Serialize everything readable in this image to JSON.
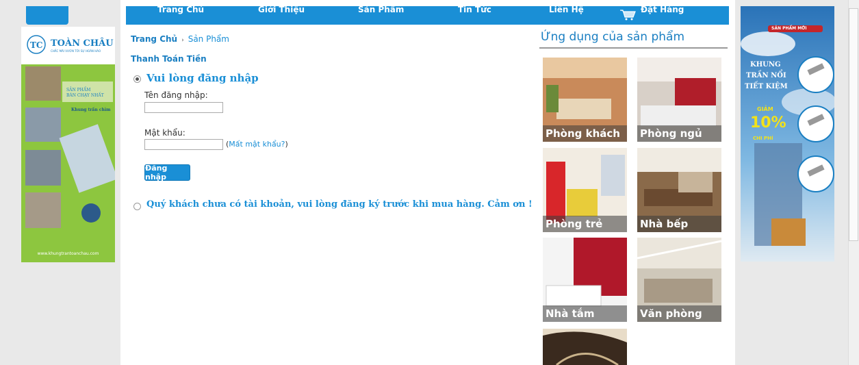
{
  "nav": {
    "items": [
      "Trang Chủ",
      "Giới Thiệu",
      "Sản Phẩm",
      "Tin Tức",
      "Liên Hệ",
      "Đặt Hàng"
    ]
  },
  "breadcrumb": {
    "home": "Trang Chủ",
    "separator": "›",
    "current": "Sản Phẩm"
  },
  "page_title": "Thanh Toán Tiền",
  "login": {
    "title": "Vui lòng đăng nhập",
    "username_label": "Tên đăng nhập:",
    "password_label": "Mật khẩu:",
    "forgot_open": "(",
    "forgot_link": "Mất mật khẩu?",
    "forgot_close": ")",
    "button": "Đăng nhập"
  },
  "register_option": "Quý khách chưa có tài khoản, vui lòng đăng ký trước khi mua hàng. Cảm ơn !",
  "applications": {
    "title": "Ứng dụng của sản phẩm",
    "tiles": [
      "Phòng khách",
      "Phòng ngủ",
      "Phòng trẻ",
      "Nhà bếp",
      "Nhà tắm",
      "Văn phòng"
    ]
  },
  "left_banner": {
    "brand": "TOÀN CHÂU",
    "tagline": "CHẮC MÃI VƯƠN TỚI SỰ HOÀN HẢO",
    "bestseller_1": "SẢN PHẨM",
    "bestseller_2": "BÁN CHẠY NHẤT",
    "product": "Khung trần chìm",
    "website": "www.khungtrantoanchau.com"
  },
  "right_banner": {
    "tag": "SẢN PHẨM MỚI",
    "line1": "KHUNG",
    "line2": "TRẦN NỔI",
    "line3": "TIẾT KIỆM",
    "discount_label": "GIẢM",
    "discount_value": "10%",
    "discount_sub": "CHI PHÍ"
  },
  "colors": {
    "accent": "#1a8fd6",
    "link": "#1a7fc2",
    "banner_green": "#8dc63f"
  }
}
